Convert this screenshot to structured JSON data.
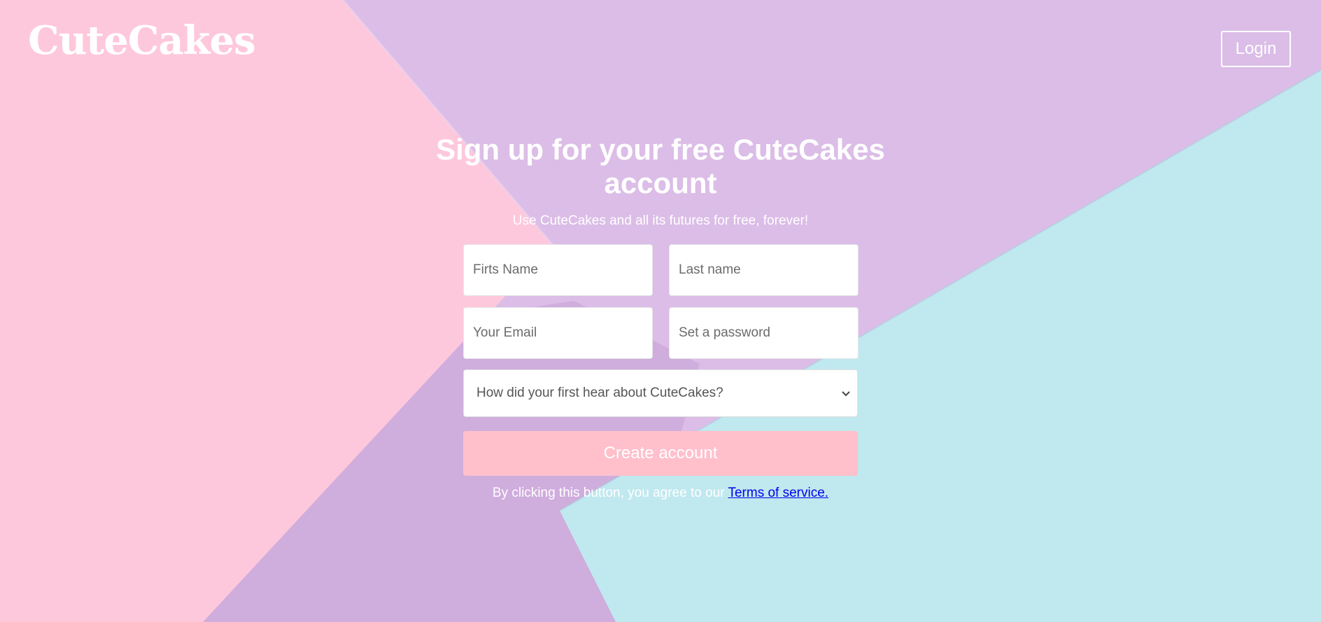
{
  "header": {
    "logo_text": "CuteCakes",
    "login_label": "Login"
  },
  "signup": {
    "title": "Sign up for your free CuteCakes account",
    "subtitle": "Use CuteCakes and all its futures for free, forever!",
    "first_name_placeholder": "Firts Name",
    "last_name_placeholder": "Last name",
    "email_placeholder": "Your Email",
    "password_placeholder": "Set a password",
    "referral_select_value": "How did your first hear about CuteCakes?",
    "create_button_label": "Create account",
    "terms_prefix": "By clicking this button, you agree to our",
    "terms_link_label": "Terms of service."
  },
  "colors": {
    "pink_panel": "#fec8dc",
    "lavender_panel": "#dbbde7",
    "purple_panel": "#d0aedd",
    "cyan_panel": "#c0e8ef",
    "button_pink": "#ffc0cb",
    "link_blue": "#0000ee"
  },
  "icons": {
    "select_chevron": "chevron-down-icon"
  }
}
